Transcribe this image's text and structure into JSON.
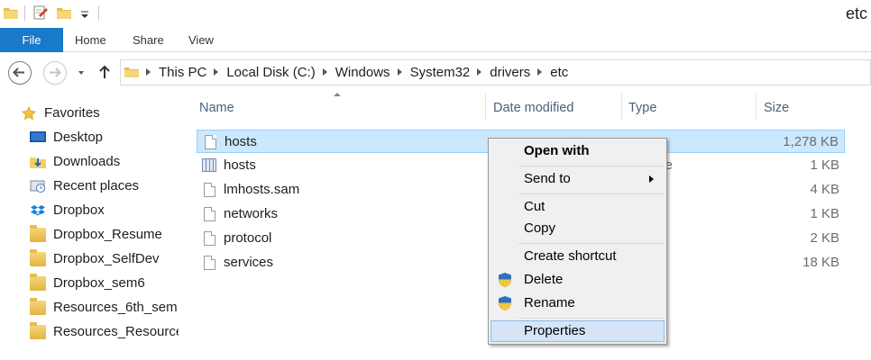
{
  "window": {
    "title": "etc"
  },
  "ribbon": {
    "file": "File",
    "tabs": [
      "Home",
      "Share",
      "View"
    ]
  },
  "breadcrumb": [
    "This PC",
    "Local Disk (C:)",
    "Windows",
    "System32",
    "drivers",
    "etc"
  ],
  "navpane": {
    "items": [
      {
        "label": "Favorites",
        "icon": "star-icon"
      },
      {
        "label": "Desktop",
        "icon": "desktop-icon"
      },
      {
        "label": "Downloads",
        "icon": "downloads-icon"
      },
      {
        "label": "Recent places",
        "icon": "recent-places-icon"
      },
      {
        "label": "Dropbox",
        "icon": "dropbox-icon"
      },
      {
        "label": "Dropbox_Resume",
        "icon": "folder-icon"
      },
      {
        "label": "Dropbox_SelfDev",
        "icon": "folder-icon"
      },
      {
        "label": "Dropbox_sem6",
        "icon": "folder-icon"
      },
      {
        "label": "Resources_6th_sem",
        "icon": "folder-icon"
      },
      {
        "label": "Resources_Resources",
        "icon": "folder-icon"
      }
    ]
  },
  "columns": {
    "name": "Name",
    "date": "Date modified",
    "type": "Type",
    "size": "Size"
  },
  "files": [
    {
      "name": "hosts",
      "date": "",
      "type": "",
      "size": "1,278 KB",
      "selected": true,
      "icon": "file-icon"
    },
    {
      "name": "hosts",
      "date": "",
      "type": "dar File",
      "size": "1 KB",
      "selected": false,
      "icon": "calendar-file-icon"
    },
    {
      "name": "lmhosts.sam",
      "date": "",
      "type": "ile",
      "size": "4 KB",
      "selected": false,
      "icon": "file-icon"
    },
    {
      "name": "networks",
      "date": "",
      "type": "",
      "size": "1 KB",
      "selected": false,
      "icon": "file-icon"
    },
    {
      "name": "protocol",
      "date": "",
      "type": "",
      "size": "2 KB",
      "selected": false,
      "icon": "file-icon"
    },
    {
      "name": "services",
      "date": "",
      "type": "",
      "size": "18 KB",
      "selected": false,
      "icon": "file-icon"
    }
  ],
  "context_menu": {
    "open_with": "Open with",
    "send_to": "Send to",
    "cut": "Cut",
    "copy": "Copy",
    "create_shortcut": "Create shortcut",
    "delete": "Delete",
    "rename": "Rename",
    "properties": "Properties"
  }
}
